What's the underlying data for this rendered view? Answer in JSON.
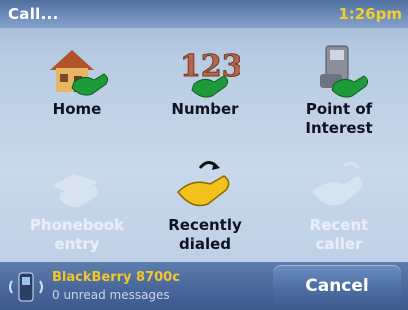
{
  "header": {
    "title": "Call...",
    "time": "1:26pm"
  },
  "options": [
    {
      "label": "Home",
      "icon": "home-phone-icon",
      "enabled": true
    },
    {
      "label": "Number",
      "icon": "number-phone-icon",
      "enabled": true
    },
    {
      "label": "Point of\nInterest",
      "icon": "poi-phone-icon",
      "enabled": true
    },
    {
      "label": "Phonebook\nentry",
      "icon": "phonebook-icon",
      "enabled": false
    },
    {
      "label": "Recently\ndialed",
      "icon": "recently-dialed-icon",
      "enabled": true
    },
    {
      "label": "Recent\ncaller",
      "icon": "recent-caller-icon",
      "enabled": false
    }
  ],
  "footer": {
    "device_name": "BlackBerry 8700c",
    "device_status": "0 unread messages",
    "cancel_label": "Cancel"
  },
  "colors": {
    "accent": "#f3c62b",
    "handset_green": "#1f9a3a",
    "handset_yellow": "#f1c21b"
  }
}
